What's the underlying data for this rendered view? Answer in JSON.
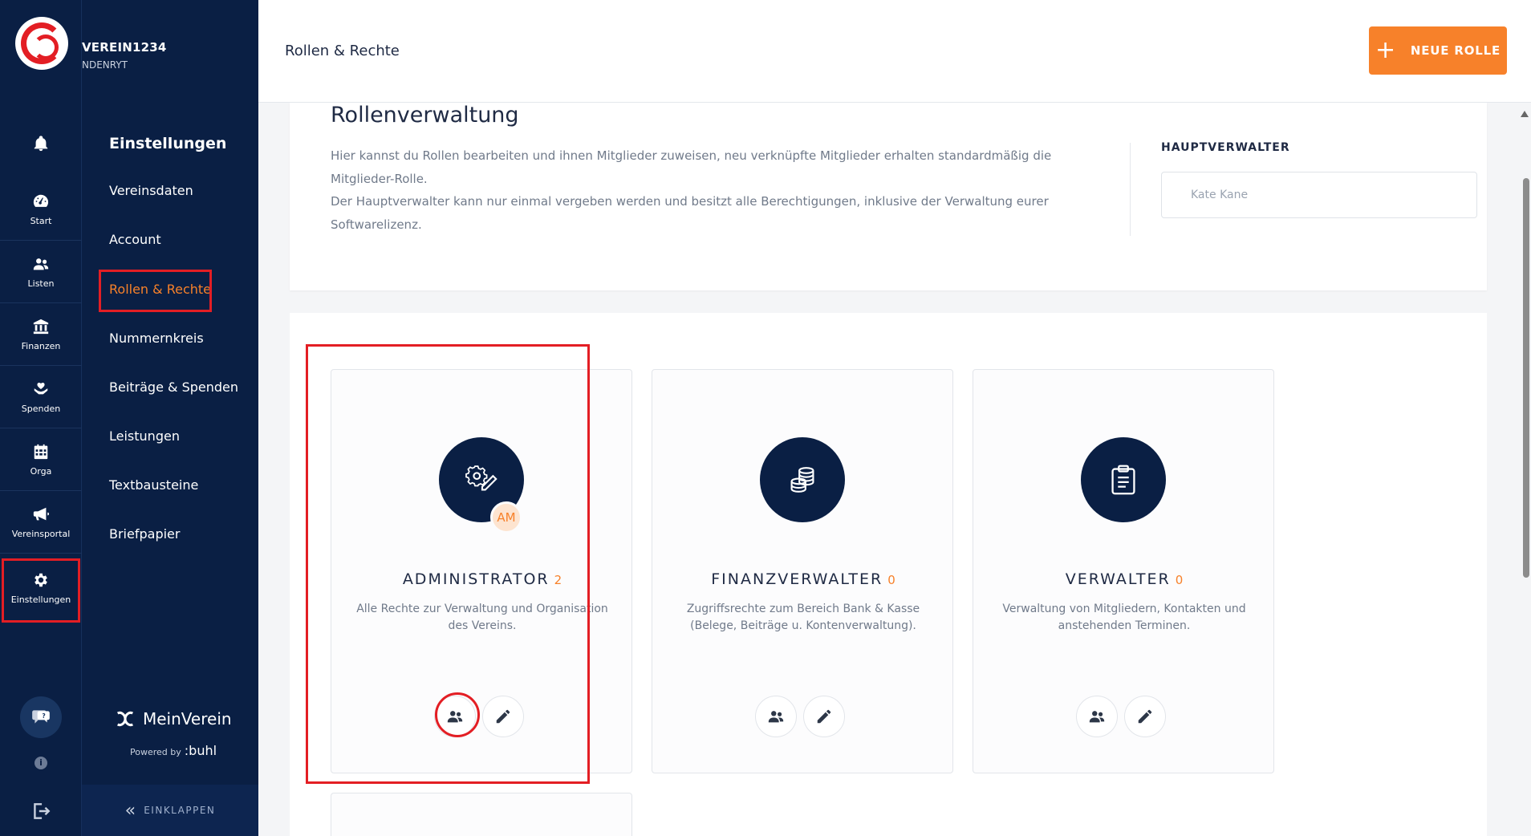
{
  "org": {
    "name": "VEREIN1234",
    "sub": "NDENRYT"
  },
  "rail": {
    "items": [
      {
        "label": "Start",
        "icon": "gauge-icon"
      },
      {
        "label": "Listen",
        "icon": "users-icon"
      },
      {
        "label": "Finanzen",
        "icon": "bank-icon"
      },
      {
        "label": "Spenden",
        "icon": "heart-hand-icon"
      },
      {
        "label": "Orga",
        "icon": "calendar-icon"
      },
      {
        "label": "Vereinsportal",
        "icon": "megaphone-icon"
      },
      {
        "label": "Einstellungen",
        "icon": "gear-icon"
      }
    ],
    "info": "i"
  },
  "submenu": {
    "title": "Einstellungen",
    "items": [
      {
        "label": "Vereinsdaten"
      },
      {
        "label": "Account"
      },
      {
        "label": "Rollen & Rechte"
      },
      {
        "label": "Nummernkreis"
      },
      {
        "label": "Beiträge & Spenden"
      },
      {
        "label": "Leistungen"
      },
      {
        "label": "Textbausteine"
      },
      {
        "label": "Briefpapier"
      }
    ],
    "brand": "MeinVerein",
    "powered_by": "Powered by",
    "powered_brand": ":buhl",
    "collapse": "EINKLAPPEN"
  },
  "header": {
    "title": "Rollen & Rechte",
    "new_role": "NEUE ROLLE"
  },
  "info": {
    "heading": "Rollenverwaltung",
    "text1": "Hier kannst du Rollen bearbeiten und ihnen Mitglieder zuweisen, neu verknüpfte Mitglieder erhalten standardmäßig die Mitglieder-Rolle.",
    "text2": "Der Hauptverwalter kann nur einmal vergeben werden und besitzt alle Berechtigungen, inklusive der Verwaltung eurer Softwarelizenz.",
    "hauptverwalter_label": "HAUPTVERWALTER",
    "hauptverwalter_value": "Kate Kane"
  },
  "roles": [
    {
      "name": "ADMINISTRATOR",
      "count": "2",
      "desc": "Alle Rechte zur Verwaltung und Organisation des Vereins.",
      "badge": "AM",
      "icon": "gear-pen-icon"
    },
    {
      "name": "FINANZVERWALTER",
      "count": "0",
      "desc": "Zugriffsrechte zum Bereich Bank & Kasse (Belege, Beiträge u. Kontenverwaltung).",
      "icon": "coins-icon"
    },
    {
      "name": "VERWALTER",
      "count": "0",
      "desc": "Verwaltung von Mitgliedern, Kontakten und anstehenden Terminen.",
      "icon": "clipboard-icon"
    }
  ],
  "colors": {
    "navy": "#0a1f44",
    "accent": "#f7812a",
    "highlight": "#e31e24"
  }
}
